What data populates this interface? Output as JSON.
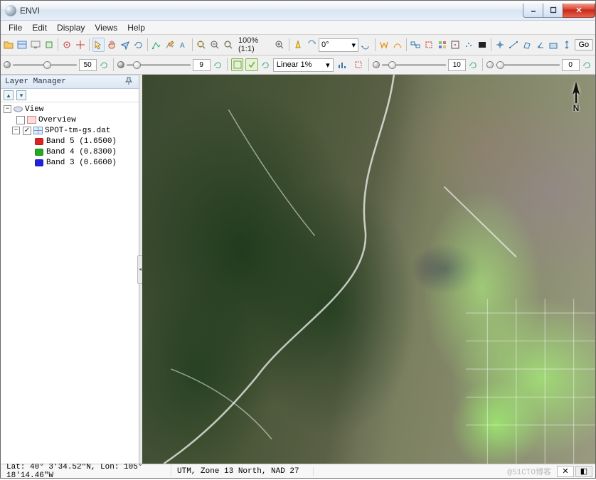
{
  "window": {
    "title": "ENVI"
  },
  "menu": {
    "file": "File",
    "edit": "Edit",
    "display": "Display",
    "views": "Views",
    "help": "Help"
  },
  "toolbar": {
    "zoom_label": "100% (1:1)",
    "rotation": "0°",
    "go": "Go"
  },
  "sliders": {
    "brightness": "50",
    "contrast": "9",
    "stretch": "Linear 1%",
    "sharpen": "10",
    "transparency": "0"
  },
  "layer_panel": {
    "title": "Layer Manager",
    "root": "View",
    "overview": "Overview",
    "dataset": "SPOT-tm-gs.dat",
    "bands": [
      {
        "label": "Band 5 (1.6500)",
        "color": "r"
      },
      {
        "label": "Band 4 (0.8300)",
        "color": "g"
      },
      {
        "label": "Band 3 (0.6600)",
        "color": "b"
      }
    ]
  },
  "compass": {
    "n": "N"
  },
  "status": {
    "coords": "Lat: 40° 3'34.52\"N, Lon: 105° 18'14.46\"W",
    "proj": "UTM, Zone 13 North, NAD 27"
  },
  "watermark": "@51CTO博客"
}
